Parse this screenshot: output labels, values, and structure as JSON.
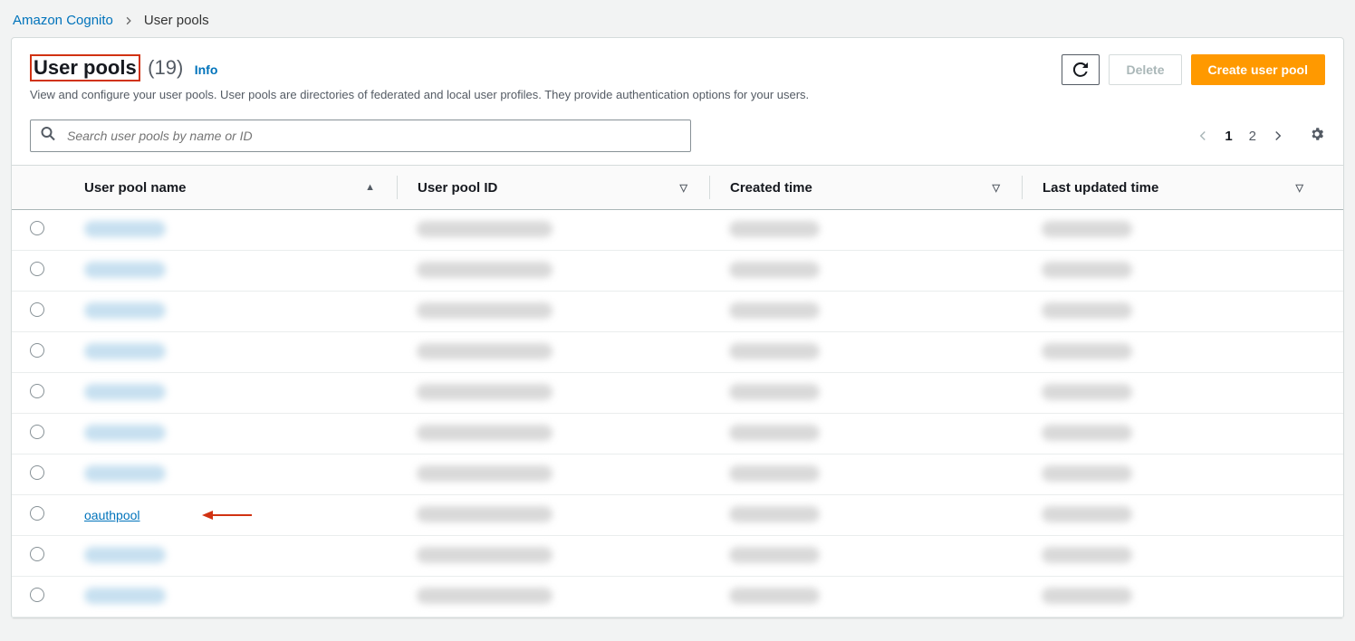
{
  "breadcrumb": {
    "root": "Amazon Cognito",
    "current": "User pools"
  },
  "header": {
    "title": "User pools",
    "count": "(19)",
    "info": "Info",
    "subtitle": "View and configure your user pools. User pools are directories of federated and local user profiles. They provide authentication options for your users."
  },
  "actions": {
    "delete": "Delete",
    "create": "Create user pool"
  },
  "search": {
    "placeholder": "Search user pools by name or ID"
  },
  "pagination": {
    "page1": "1",
    "page2": "2"
  },
  "columns": {
    "name": "User pool name",
    "id": "User pool ID",
    "created": "Created time",
    "updated": "Last updated time"
  },
  "rows": [
    {
      "name_hidden": true
    },
    {
      "name_hidden": true
    },
    {
      "name_hidden": true
    },
    {
      "name_hidden": true
    },
    {
      "name_hidden": true
    },
    {
      "name_hidden": true
    },
    {
      "name_hidden": true
    },
    {
      "name": "oauthpool",
      "highlighted": true
    },
    {
      "name_hidden": true
    },
    {
      "name_hidden": true
    }
  ]
}
